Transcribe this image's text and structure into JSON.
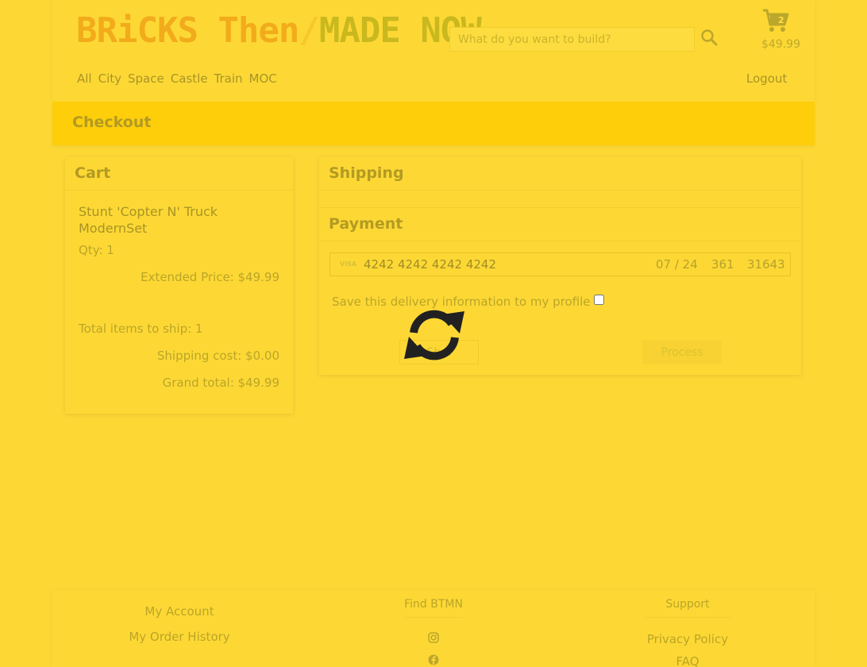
{
  "header": {
    "logo": {
      "part1": "BRiCKS Then",
      "slash": "/",
      "part2": "MADE NOW"
    },
    "search": {
      "placeholder": "What do you want to build?"
    },
    "cart": {
      "count": "2",
      "total": "$49.99"
    },
    "nav": [
      "All",
      "City",
      "Space",
      "Castle",
      "Train",
      "MOC"
    ],
    "logout": "Logout"
  },
  "banner": {
    "title": "Checkout"
  },
  "cart": {
    "title": "Cart",
    "item_name": "Stunt 'Copter N' Truck ModernSet",
    "qty": "Qty: 1",
    "extended_price": "Extended Price: $49.99",
    "total_items": "Total items to ship: 1",
    "shipping_cost": "Shipping cost: $0.00",
    "grand_total": "Grand total: $49.99"
  },
  "shipping": {
    "title": "Shipping"
  },
  "payment": {
    "title": "Payment",
    "card_brand": "VISA",
    "card_number": "4242 4242 4242 4242",
    "expiry": "07 / 24",
    "cvc": "361",
    "zip": "31643",
    "save_label": "Save this delivery information to my profile",
    "back_button": "Sh...",
    "process_button": "Process"
  },
  "footer": {
    "account_links": [
      "My Account",
      "My Order History"
    ],
    "find_heading": "Find BTMN",
    "support_heading": "Support",
    "support_links": [
      "Privacy Policy",
      "FAQ"
    ]
  },
  "colors": {
    "background": "#fdd835",
    "banner": "#fece0b",
    "text": "#bba527",
    "spinner": "#212121"
  }
}
